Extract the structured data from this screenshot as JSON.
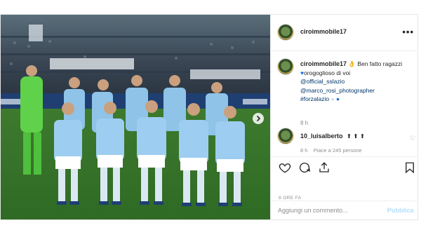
{
  "post": {
    "username": "ciroimmobile17",
    "more_icon": "more-horizontal-icon"
  },
  "caption": {
    "username": "ciroimmobile17",
    "line1": "Ben fatto ragazzi",
    "line2": "orogoglioso di voi",
    "mention1": "@official_sslazio",
    "mention2": "@marco_rosi_photographer",
    "hashtag": "#forzalazio",
    "time": "8 h"
  },
  "comment": {
    "username": "10_luisalberto",
    "emojis": "⬆ ⬆ ⬆",
    "time": "8 h",
    "likes": "Piace a 245 persone"
  },
  "post_age": "8 ORE FA",
  "add_comment": {
    "placeholder": "Aggiungi un commento...",
    "publish_label": "Pubblica"
  },
  "colors": {
    "link": "#00376b",
    "accent": "#3897f0",
    "publish_disabled": "#b2dffc",
    "lazio_blue": "#8fc3e8",
    "keeper_green": "#5fd14a"
  },
  "carousel": {
    "total": 4,
    "active": 1
  }
}
